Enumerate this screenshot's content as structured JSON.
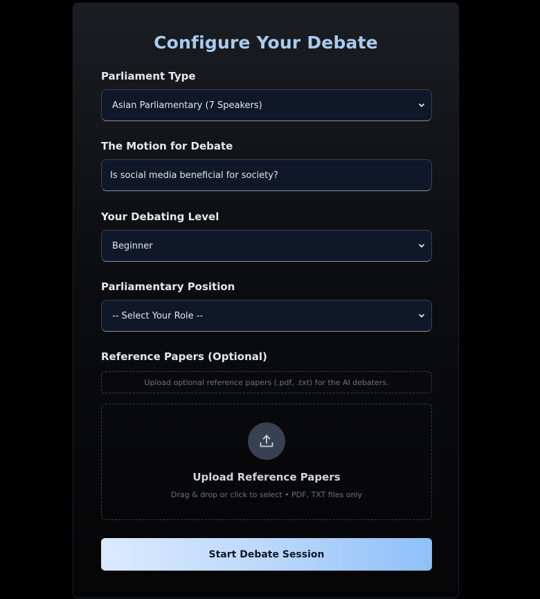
{
  "page": {
    "title": "Configure Your Debate"
  },
  "colors": {
    "title": "#a8cbf0",
    "field_bg": "#0f1729",
    "button_gradient_start": "#dbeafe",
    "button_gradient_end": "#8ec0f8"
  },
  "form": {
    "parliament_type": {
      "label": "Parliament Type",
      "selected": "Asian Parliamentary (7 Speakers)"
    },
    "motion": {
      "label": "The Motion for Debate",
      "value": "Is social media beneficial for society?"
    },
    "level": {
      "label": "Your Debating Level",
      "selected": "Beginner"
    },
    "position": {
      "label": "Parliamentary Position",
      "selected": "-- Select Your Role --"
    },
    "references": {
      "label": "Reference Papers (Optional)",
      "hint": "Upload optional reference papers (.pdf, .txt) for the AI debaters.",
      "upload_icon": "upload-icon",
      "upload_title": "Upload Reference Papers",
      "upload_subtitle": "Drag & drop or click to select • PDF, TXT files only"
    },
    "submit_label": "Start Debate Session"
  }
}
